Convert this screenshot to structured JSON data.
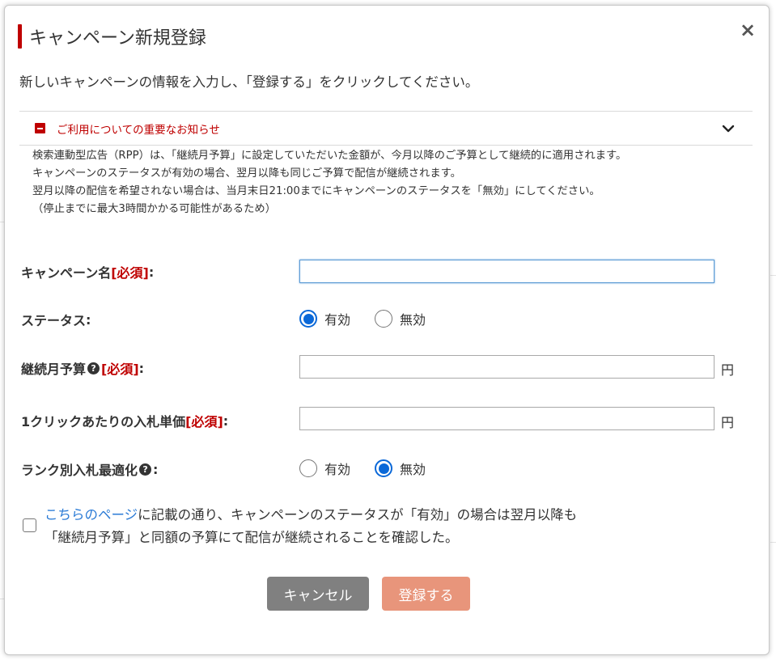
{
  "modal": {
    "title": "キャンペーン新規登録",
    "close": "×",
    "intro": "新しいキャンペーンの情報を入力し、「登録する」をクリックしてください。"
  },
  "notice": {
    "title": "ご利用についての重要なお知らせ",
    "lines": [
      "検索連動型広告（RPP）は、「継続月予算」に設定していただいた金額が、今月以降のご予算として継続的に適用されます。",
      "キャンペーンのステータスが有効の場合、翌月以降も同じご予算で配信が継続されます。",
      "翌月以降の配信を希望されない場合は、当月末日21:00までにキャンペーンのステータスを「無効」にしてください。",
      "（停止までに最大3時間かかる可能性があるため）"
    ]
  },
  "form": {
    "required": "[必須]",
    "colon": ":",
    "campaign_name": {
      "label": "キャンペーン名",
      "value": ""
    },
    "status": {
      "label": "ステータス",
      "options": [
        "有効",
        "無効"
      ],
      "selected": "有効"
    },
    "monthly_budget": {
      "label": "継続月予算",
      "value": "",
      "unit": "円"
    },
    "bid_price": {
      "label": "1クリックあたりの入札単価",
      "value": "",
      "unit": "円"
    },
    "rank_opt": {
      "label": "ランク別入札最適化",
      "options": [
        "有効",
        "無効"
      ],
      "selected": "無効"
    }
  },
  "confirm": {
    "checked": false,
    "link_text": "こちらのページ",
    "text": "に記載の通り、キャンペーンのステータスが「有効」の場合は翌月以降も「継続月予算」と同額の予算にて配信が継続されることを確認した。"
  },
  "buttons": {
    "cancel": "キャンセル",
    "submit": "登録する"
  },
  "colors": {
    "accent": "#bf0000",
    "radio": "#0a68d8",
    "link": "#2b7bd6",
    "cancel_bg": "#808080",
    "submit_bg": "#e8957b"
  },
  "icons": {
    "close": "close-icon",
    "notice": "minus-square-icon",
    "toggle": "chevron-down-icon",
    "help": "question-circle-icon"
  }
}
